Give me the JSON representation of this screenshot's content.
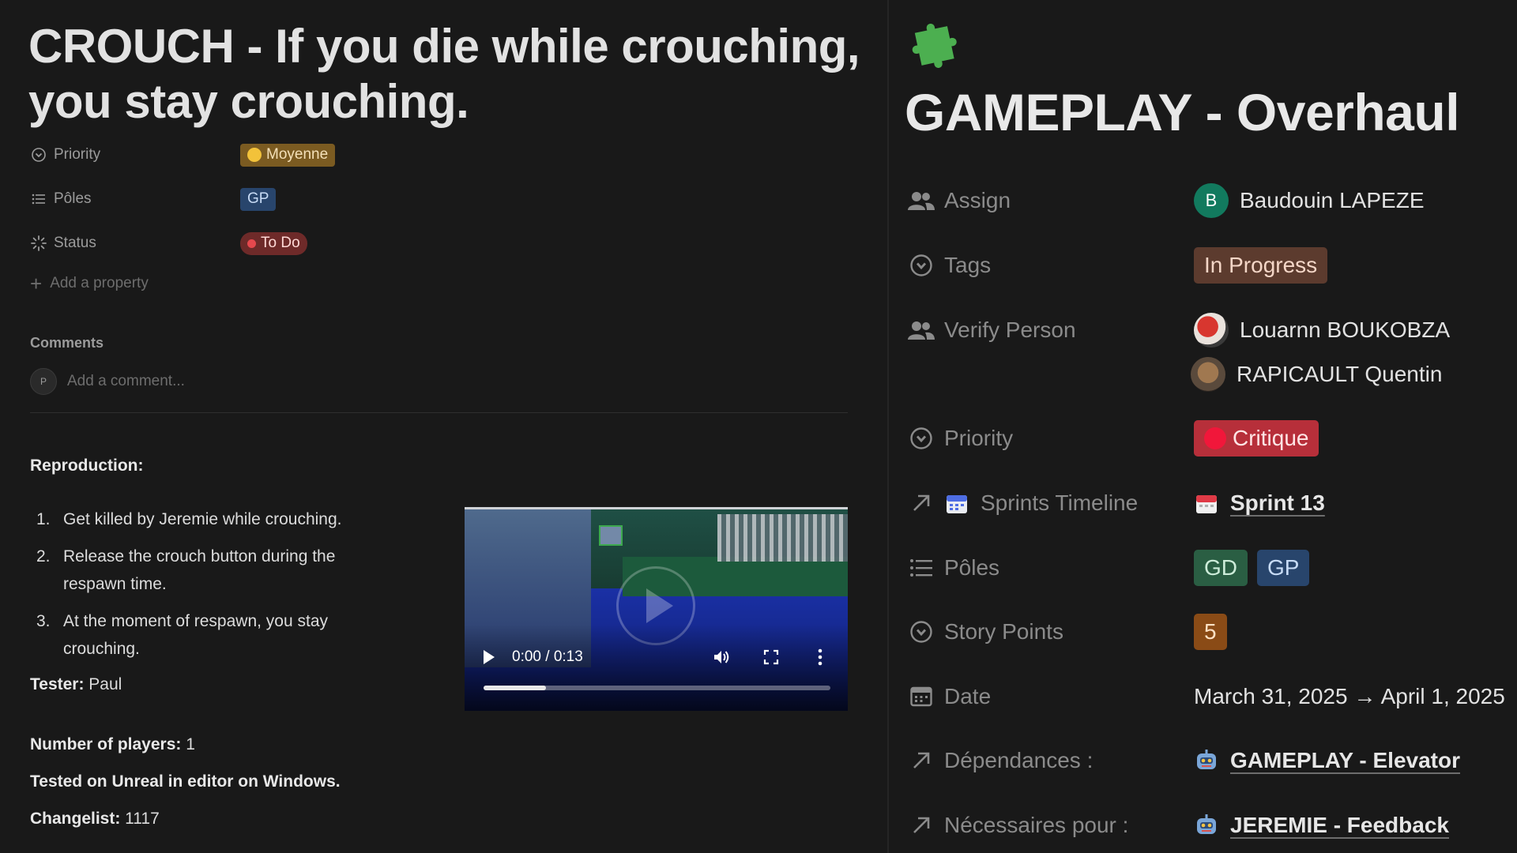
{
  "left": {
    "title": "CROUCH - If you die while crouching, you stay crouching.",
    "properties": [
      {
        "label": "Priority",
        "value": "Moyenne"
      },
      {
        "label": "Pôles",
        "value": "GP"
      },
      {
        "label": "Status",
        "value": "To Do"
      }
    ],
    "add_property": "Add a property",
    "comments_heading": "Comments",
    "comment_avatar": "P",
    "comment_placeholder": "Add a comment...",
    "reproduction_heading": "Reproduction:",
    "steps": [
      {
        "num": "1.",
        "text": "Get killed by Jeremie while crouching."
      },
      {
        "num": "2.",
        "text": "Release the crouch button during the respawn time."
      },
      {
        "num": "3.",
        "text": "At the moment of respawn, you stay crouching."
      }
    ],
    "tester_label": "Tester:",
    "tester_value": " Paul",
    "players_label": "Number of players:",
    "players_value": " 1",
    "tested_on": "Tested on Unreal in editor on Windows.",
    "changelist_label": "Changelist:",
    "changelist_value": " 1117",
    "video": {
      "time": "0:00 / 0:13",
      "progress": 0.18
    }
  },
  "right": {
    "title": "GAMEPLAY - Overhaul",
    "page_icon": "puzzle-piece-icon",
    "assign": {
      "label": "Assign",
      "avatar_letter": "B",
      "name": "Baudouin LAPEZE"
    },
    "tags": {
      "label": "Tags",
      "value": "In Progress"
    },
    "verify": {
      "label": "Verify Person",
      "people": [
        "Louarnn BOUKOBZA",
        "RAPICAULT Quentin"
      ]
    },
    "priority": {
      "label": "Priority",
      "value": "Critique"
    },
    "sprints": {
      "label": "Sprints Timeline",
      "value": "Sprint 13"
    },
    "poles": {
      "label": "Pôles",
      "values": [
        "GD",
        "GP"
      ]
    },
    "story_points": {
      "label": "Story Points",
      "value": "5"
    },
    "date": {
      "label": "Date",
      "value": "March 31, 2025 → April 1, 2025"
    },
    "dependances": {
      "label": "Dépendances :",
      "value": "GAMEPLAY - Elevator"
    },
    "necessaires": {
      "label": "Nécessaires pour :",
      "value": "JEREMIE - Feedback"
    }
  },
  "colors": {
    "background": "#191919",
    "moyenne": "#7b5b21",
    "todo": "#6e2a29",
    "in_progress": "#5c3b2e",
    "critique": "#b72f3a",
    "gd": "#2a5e43",
    "gp": "#28456c",
    "story_points": "#8a4b16",
    "puzzle": "#4caf50"
  }
}
